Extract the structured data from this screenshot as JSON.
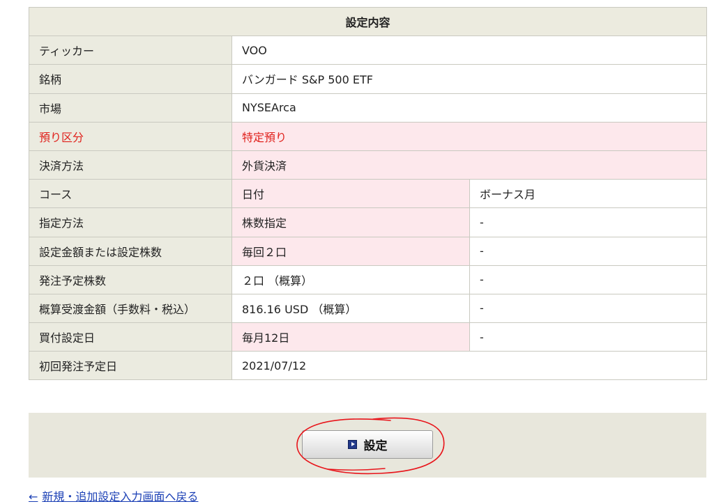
{
  "table": {
    "header": "設定内容",
    "rows": [
      {
        "label": "ティッカー",
        "value": "VOO"
      },
      {
        "label": "銘柄",
        "value": "バンガード S&P 500 ETF"
      },
      {
        "label": "市場",
        "value": "NYSEArca"
      },
      {
        "label": "預り区分",
        "value": "特定預り"
      },
      {
        "label": "決済方法",
        "value": "外貨決済"
      },
      {
        "label": "コース",
        "value": "日付",
        "value2": "ボーナス月"
      },
      {
        "label": "指定方法",
        "value": "株数指定",
        "value2": "-"
      },
      {
        "label": "設定金額または設定株数",
        "value": "毎回２口",
        "value2": "-"
      },
      {
        "label": "発注予定株数",
        "value": "２口 （概算）",
        "value2": "-"
      },
      {
        "label": "概算受渡金額（手数料・税込）",
        "value": "816.16 USD （概算）",
        "value2": "-"
      },
      {
        "label": "買付設定日",
        "value": "毎月12日",
        "value2": "-"
      },
      {
        "label": "初回発注予定日",
        "value": "2021/07/12"
      }
    ]
  },
  "action": {
    "button_label": "設定",
    "icon": "play-square-icon"
  },
  "back_link": {
    "arrow": "←",
    "label": "新規・追加設定入力画面へ戻る"
  },
  "colors": {
    "header_bg": "#ecebdf",
    "label_bg": "#ebebe0",
    "highlight_bg": "#fde8ec",
    "alert_text": "#e0201b",
    "annotation_red": "#e8141a",
    "link": "#1a3fb5"
  }
}
